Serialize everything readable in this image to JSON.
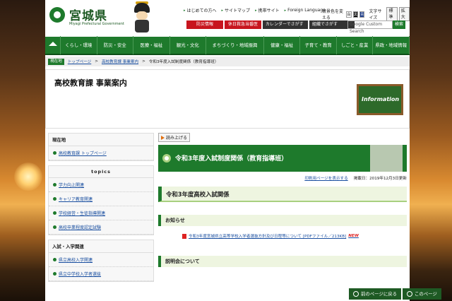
{
  "header": {
    "logo_title": "宮城県",
    "logo_subtitle": "Miyagi Prefectural Government",
    "top_links": [
      "はじめての方へ",
      "サイトマップ",
      "携帯サイト",
      "Foreign Language"
    ],
    "bg_color_label": "背景色を変える",
    "swatches": [
      "白",
      "黒",
      "青"
    ],
    "text_size_label": "文字サイズ",
    "text_standard": "標準",
    "text_large": "拡大",
    "red_buttons": [
      "防災情報",
      "休日救急当番医"
    ],
    "dark_buttons": [
      "カレンダーでさがす",
      "組織でさがす"
    ],
    "search_placeholder": "Google Custom Search",
    "search_button": "検索"
  },
  "global_nav": [
    "くらし・環境",
    "防災・安全",
    "医療・福祉",
    "観光・文化",
    "まちづくり・地域振興",
    "健康・福祉",
    "子育て・教育",
    "しごと・産業",
    "県政・地域情報"
  ],
  "breadcrumb": {
    "here_label": "現在地",
    "items": [
      "トップページ",
      "高校教育課 事業案内"
    ],
    "current": "令和3年度入試制度関係（教育指導班）"
  },
  "banner": {
    "title": "高校教育課 事業案内",
    "board_text": "Information"
  },
  "sidebar": {
    "location_heading": "現在地",
    "location_link": "高校教育課 トップページ",
    "topics_heading": "topics",
    "topics": [
      "学力向上関連",
      "キャリア教育関連",
      "学校経営・生徒指導関連",
      "高校卒業程度認定試験"
    ],
    "exam_heading": "入試・入学関連",
    "exam_items": [
      "県立高校入学関連",
      "県立中学校入学者選抜"
    ]
  },
  "main": {
    "read_aloud": "読み上げる",
    "page_title": "令和3年度入試制度関係（教育指導班）",
    "print_link": "印刷用ページを表示する",
    "posted_date": "掲載日：2019年12月3日更新",
    "section_title": "令和3年度高校入試関係",
    "notice_heading": "お知らせ",
    "doc_link": "令和3年度宮城県立高等学校入学者選抜方針及び日程等について [PDFファイル／213KB]",
    "new_badge": "NEW",
    "briefing_heading": "説明会について"
  },
  "footer_bar": {
    "back_label": "前のページに戻る",
    "top_label": "このページ"
  },
  "colors": {
    "brand_green": "#1e7a2c",
    "alert_red": "#c8151e",
    "link_blue": "#1a4fa0"
  }
}
